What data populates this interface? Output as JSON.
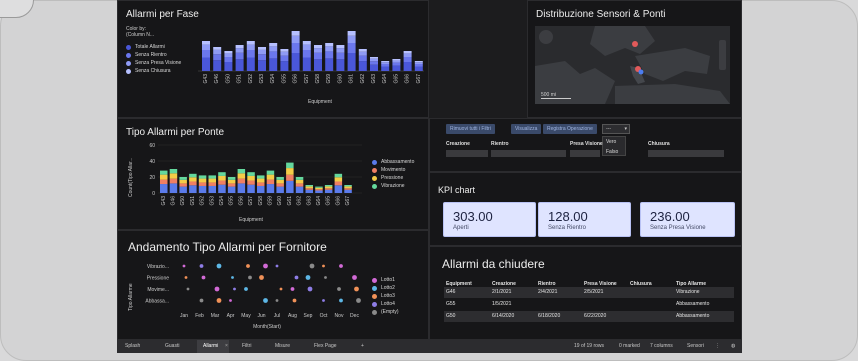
{
  "fase": {
    "title": "Allarmi per Fase",
    "color_by": "Color by:",
    "color_by_sub": "(Column N...",
    "legend": [
      {
        "label": "Totale Allarmi",
        "color": "#4a57d9"
      },
      {
        "label": "Senza Rientro",
        "color": "#6b77ec"
      },
      {
        "label": "Senza Presa Visione",
        "color": "#8f9bf5"
      },
      {
        "label": "Senza Chiusura",
        "color": "#b6c0ff"
      }
    ],
    "categories": [
      "G43",
      "G46",
      "G50",
      "G51",
      "G52",
      "G53",
      "G54",
      "G55",
      "G56",
      "G57",
      "G58",
      "G59",
      "G60",
      "G61",
      "G62",
      "G63",
      "G64",
      "G65",
      "G66",
      "G67"
    ],
    "xlabel": "Equipment"
  },
  "map": {
    "title": "Distribuzione Sensori & Ponti",
    "scale": "500 mi"
  },
  "ponte": {
    "title": "Tipo Allarmi per Ponte",
    "ylabel": "Count(Tipo Allar...",
    "xlabel": "Equipment",
    "yticks": [
      "60",
      "40",
      "20",
      "0"
    ],
    "legend": [
      {
        "label": "Abbassamento",
        "color": "#5b7bea"
      },
      {
        "label": "Movimento",
        "color": "#f07f63"
      },
      {
        "label": "Pressione",
        "color": "#f4cc47"
      },
      {
        "label": "Vibrazione",
        "color": "#64d89d"
      }
    ],
    "categories": [
      "G43",
      "G46",
      "G50",
      "G51",
      "G52",
      "G53",
      "G54",
      "G55",
      "G56",
      "G57",
      "G58",
      "G59",
      "G60",
      "G61",
      "G62",
      "G63",
      "G64",
      "G65",
      "G66",
      "G67"
    ]
  },
  "fornitore": {
    "title": "Andamento Tipo  Allarmi per Fornitore",
    "ylabel": "Tipo Allarme",
    "xlabel": "Month(Start)",
    "rows": [
      "Vibrazio...",
      "Pressione",
      "Movime...",
      "Abbassa..."
    ],
    "months": [
      "Jan",
      "Feb",
      "Mar",
      "Apr",
      "May",
      "Jun",
      "Jul",
      "Aug",
      "Sep",
      "Oct",
      "Nov",
      "Dec"
    ],
    "legend": [
      {
        "label": "Lotto1",
        "color": "#d26ad6"
      },
      {
        "label": "Lotto2",
        "color": "#5db7e6"
      },
      {
        "label": "Lotto3",
        "color": "#f09158"
      },
      {
        "label": "Lotto4",
        "color": "#8e7de6"
      },
      {
        "label": "(Empty)",
        "color": "#8a8a8a"
      }
    ]
  },
  "filters": {
    "reset": "Rimuovi tutti i Filtri",
    "show": "Visualizza",
    "register": "Registra Operazione",
    "dropdown": "---",
    "options": [
      "Vero",
      "Falso"
    ],
    "fields": [
      "Creazione",
      "Rientro",
      "Presa Visione",
      "Chiusura"
    ]
  },
  "kpi": {
    "title": "KPI chart",
    "cards": [
      {
        "value": "303.00",
        "label": "Aperti"
      },
      {
        "value": "128.00",
        "label": "Senza Rientro"
      },
      {
        "value": "236.00",
        "label": "Senza Presa Visione"
      }
    ]
  },
  "chiudere": {
    "title": "Allarmi da chiudere",
    "headers": [
      "Equipment",
      "Creazione",
      "Rientro",
      "Presa Visione",
      "Chiusura",
      "Tipo Allarme"
    ],
    "rows": [
      [
        "G46",
        "2/1/2021",
        "2/4/2021",
        "2/5/2021",
        "",
        "Vibrazione"
      ],
      [
        "G55",
        "1/5/2021",
        "",
        "",
        "",
        "Abbassamento"
      ],
      [
        "G50",
        "6/14/2020",
        "6/18/2020",
        "6/22/2020",
        "",
        "Abbassamento"
      ]
    ]
  },
  "status": {
    "tabs": [
      "Splash",
      "Guasti",
      "Allarmi",
      "Filtri",
      "Misure",
      "Flex Page"
    ],
    "rows": "19 of 19 rows",
    "marked": "0 marked",
    "columns": "7 columns",
    "sensori": "Sensori"
  }
}
